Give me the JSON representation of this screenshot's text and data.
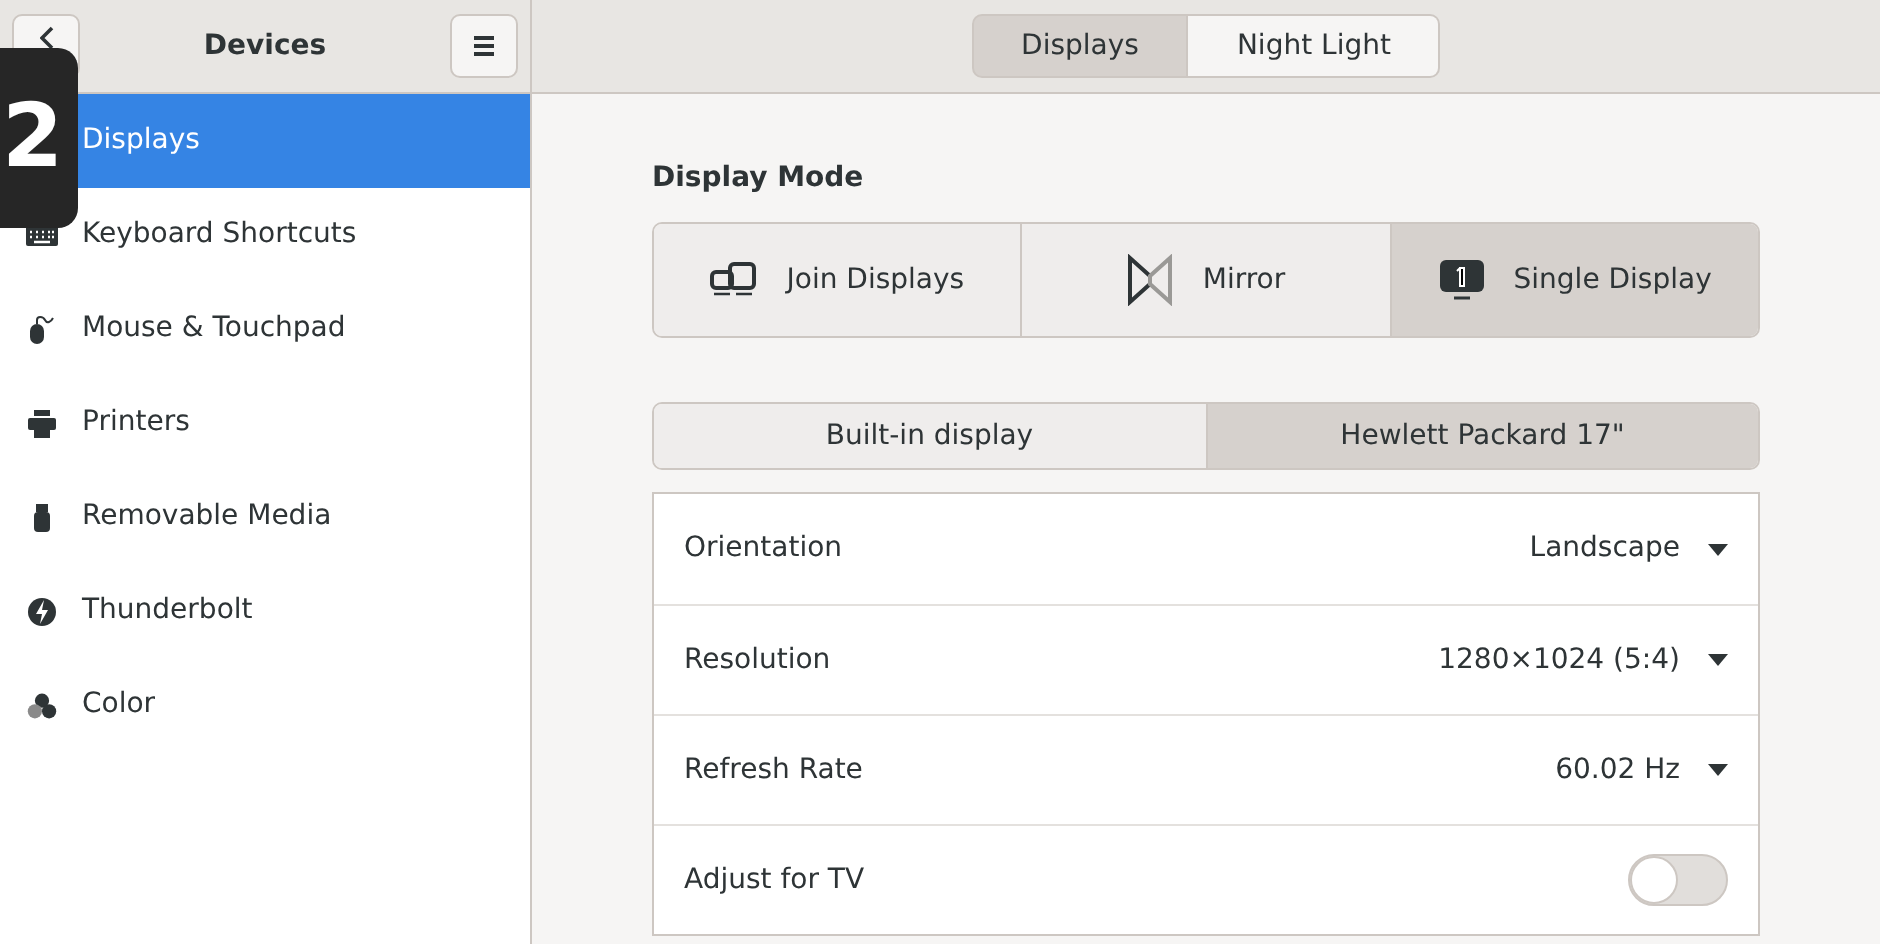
{
  "sidebar": {
    "title": "Devices",
    "items": [
      {
        "label": "Displays",
        "selected": true
      },
      {
        "label": "Keyboard Shortcuts",
        "selected": false
      },
      {
        "label": "Mouse & Touchpad",
        "selected": false
      },
      {
        "label": "Printers",
        "selected": false
      },
      {
        "label": "Removable Media",
        "selected": false
      },
      {
        "label": "Thunderbolt",
        "selected": false
      },
      {
        "label": "Color",
        "selected": false
      }
    ]
  },
  "header_tabs": [
    {
      "label": "Displays",
      "selected": true
    },
    {
      "label": "Night Light",
      "selected": false
    }
  ],
  "display_mode": {
    "title": "Display Mode",
    "options": [
      {
        "label": "Join Displays",
        "selected": false
      },
      {
        "label": "Mirror",
        "selected": false
      },
      {
        "label": "Single Display",
        "selected": true
      }
    ]
  },
  "monitor_tabs": [
    {
      "label": "Built-in display",
      "selected": false
    },
    {
      "label": "Hewlett Packard 17\"",
      "selected": true
    }
  ],
  "settings": [
    {
      "kind": "dropdown",
      "label": "Orientation",
      "value": "Landscape"
    },
    {
      "kind": "dropdown",
      "label": "Resolution",
      "value": "1280×1024 (5:4)"
    },
    {
      "kind": "dropdown",
      "label": "Refresh Rate",
      "value": "60.02 Hz"
    },
    {
      "kind": "switch",
      "label": "Adjust for TV",
      "on": false
    }
  ],
  "monitor_label": "2"
}
